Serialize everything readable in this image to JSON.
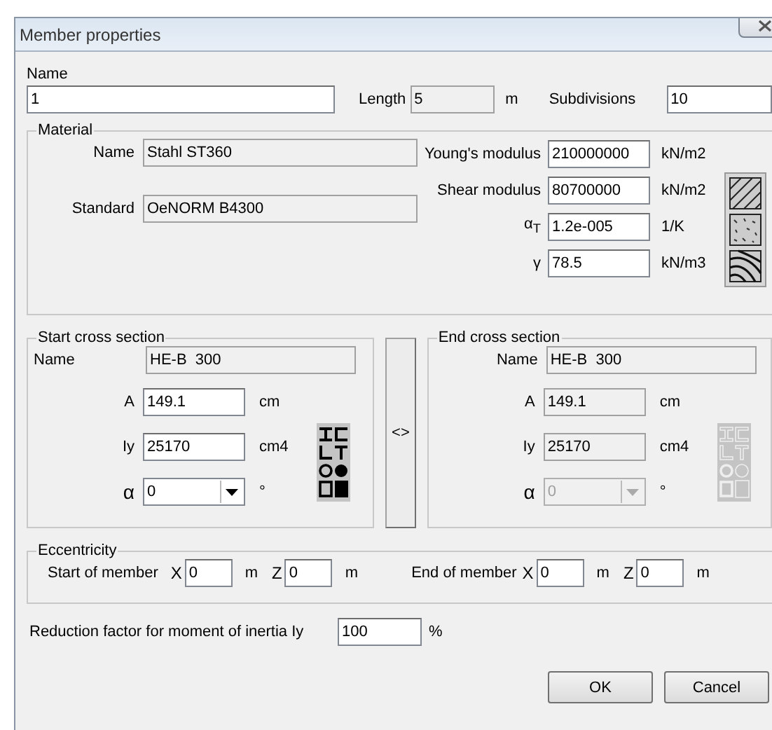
{
  "window": {
    "title": "Member properties"
  },
  "name": {
    "label": "Name",
    "value": "1",
    "editable": true
  },
  "length": {
    "label": "Length",
    "value": "5",
    "unit": "m",
    "editable": false
  },
  "subdivisions": {
    "label": "Subdivisions",
    "value": "10",
    "editable": true
  },
  "material": {
    "title": "Material",
    "name": {
      "label": "Name",
      "value": "Stahl ST360",
      "editable": false
    },
    "standard": {
      "label": "Standard",
      "value": "OeNORM B4300",
      "editable": false
    },
    "properties": [
      {
        "label": "Young's modulus",
        "value": "210000000",
        "unit": "kN/m2",
        "editable": true
      },
      {
        "label": "Shear modulus",
        "value": "80700000",
        "unit": "kN/m2",
        "editable": true
      },
      {
        "label": "α$_{T}$",
        "value": "1.2e-005",
        "unit": "1/K",
        "editable": true
      },
      {
        "label": "γ",
        "value": "78.5",
        "unit": "kN/m3",
        "editable": true
      }
    ]
  },
  "sections": [
    {
      "title": "Start cross section",
      "disabled": false,
      "name": {
        "label": "Name",
        "value": "HE-B  300"
      },
      "fields": [
        {
          "label": "A",
          "value": "149.1",
          "unit": "cm",
          "editable": true
        },
        {
          "label": "Iy",
          "value": "25170",
          "unit": "cm4",
          "editable": true
        }
      ],
      "angle": {
        "label": "α",
        "value": "0",
        "unit": "°"
      }
    },
    {
      "title": "End cross section",
      "disabled": true,
      "name": {
        "label": "Name",
        "value": "HE-B  300"
      },
      "fields": [
        {
          "label": "A",
          "value": "149.1",
          "unit": "cm",
          "editable": false
        },
        {
          "label": "Iy",
          "value": "25170",
          "unit": "cm4",
          "editable": false
        }
      ],
      "angle": {
        "label": "α",
        "value": "0",
        "unit": "°"
      }
    }
  ],
  "swap_button": "<>",
  "eccentricity": {
    "title": "Eccentricity",
    "groups": [
      {
        "label": "Start of member",
        "coords": [
          {
            "axis": "X",
            "value": "0",
            "unit": "m"
          },
          {
            "axis": "Z",
            "value": "0",
            "unit": "m"
          }
        ]
      },
      {
        "label": "End of member",
        "coords": [
          {
            "axis": "X",
            "value": "0",
            "unit": "m"
          },
          {
            "axis": "Z",
            "value": "0",
            "unit": "m"
          }
        ]
      }
    ]
  },
  "reduction": {
    "label": "Reduction factor for moment of inertia Iy",
    "value": "100",
    "unit": "%"
  },
  "buttons": [
    "OK",
    "Cancel"
  ]
}
